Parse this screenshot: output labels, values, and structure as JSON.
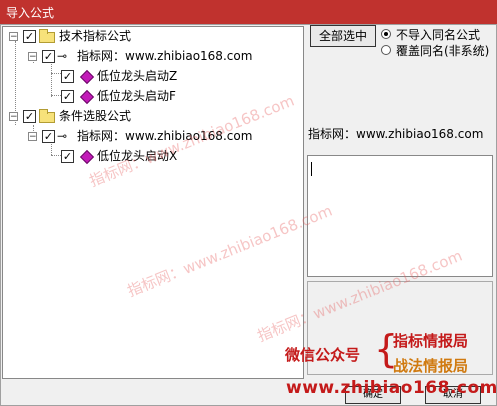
{
  "window": {
    "title": "导入公式"
  },
  "tree": {
    "root1": {
      "label": "技术指标公式",
      "checked": true,
      "expanded": true
    },
    "root1_site": {
      "label": "指标网：www.zhibiao168.com",
      "checked": true,
      "expanded": true
    },
    "root1_items": [
      {
        "label": "低位龙头启动Z",
        "checked": true
      },
      {
        "label": "低位龙头启动F",
        "checked": true
      }
    ],
    "root2": {
      "label": "条件选股公式",
      "checked": true,
      "expanded": true
    },
    "root2_site": {
      "label": "指标网：www.zhibiao168.com",
      "checked": true,
      "expanded": true
    },
    "root2_items": [
      {
        "label": "低位龙头启动X",
        "checked": true
      }
    ]
  },
  "controls": {
    "select_all": "全部选中",
    "radio_skip": "不导入同名公式",
    "radio_overwrite": "覆盖同名(非系统)",
    "selected_radio": "skip"
  },
  "detail": {
    "site_label": "指标网：www.zhibiao168.com"
  },
  "ads": {
    "wechat": "微信公众号",
    "brace": "{",
    "line1": "指标情报局",
    "line2": "战法情报局",
    "url": "www.zhibiao168.com"
  },
  "buttons": {
    "ok": "确定",
    "cancel": "取消"
  },
  "watermarks": [
    "指标网：www.zhibiao168.com",
    "指标网：www.zhibiao168.com",
    "指标网：www.zhibiao168.com"
  ],
  "colors": {
    "titlebar": "#c0322e",
    "ad_red": "#c41a1a",
    "ad_orange": "#d07a10",
    "watermark": "#e65a5a"
  },
  "icons": {
    "folder": "folder-icon",
    "key": "key-icon",
    "formula": "formula-gem-icon"
  }
}
